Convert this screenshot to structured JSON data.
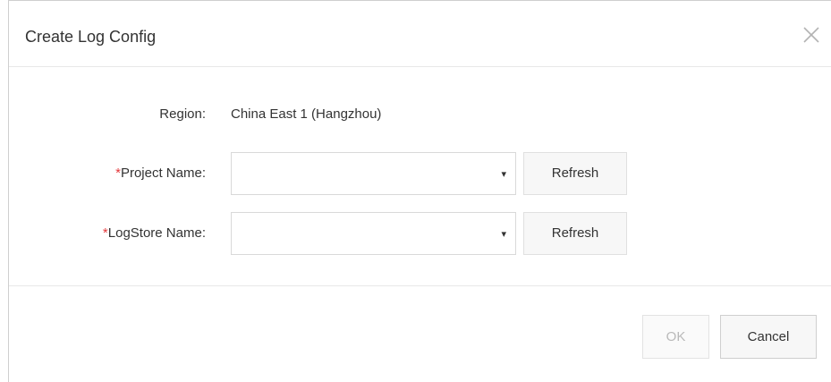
{
  "dialog": {
    "title": "Create Log Config",
    "close_icon": "close-icon"
  },
  "form": {
    "region": {
      "label": "Region:",
      "value": "China East 1 (Hangzhou)"
    },
    "project": {
      "required_mark": "*",
      "label": "Project Name:",
      "value": "",
      "arrow": "▾",
      "refresh_label": "Refresh"
    },
    "logstore": {
      "required_mark": "*",
      "label": "LogStore Name:",
      "value": "",
      "arrow": "▾",
      "refresh_label": "Refresh"
    }
  },
  "footer": {
    "ok_label": "OK",
    "ok_disabled": true,
    "cancel_label": "Cancel"
  },
  "colors": {
    "required": "#e4393c",
    "text": "#333333",
    "disabled_text": "#b9b9b9",
    "border": "#d9d9d9"
  }
}
